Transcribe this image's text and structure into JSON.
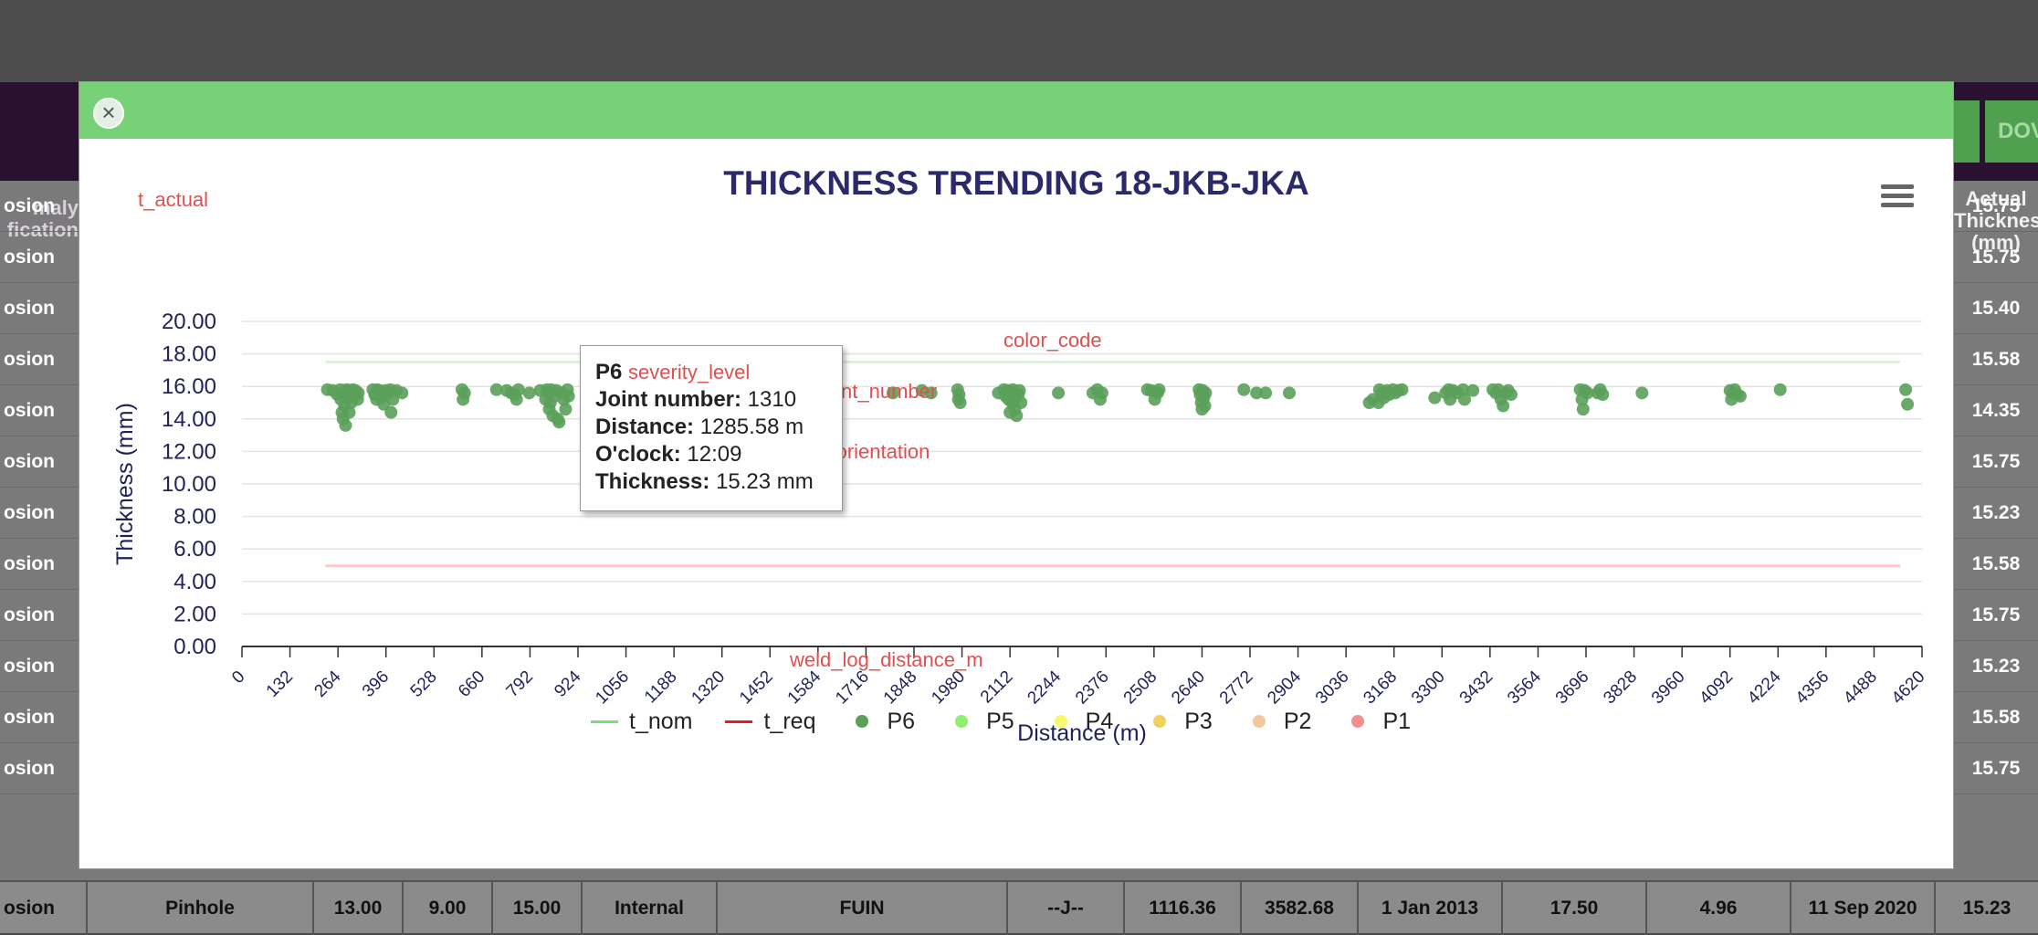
{
  "background": {
    "top_buttons": [
      "",
      "DOV"
    ],
    "left_header": [
      "maly",
      "fication"
    ],
    "right_header": [
      "Actual",
      "Thickness",
      "(mm)"
    ],
    "rows": [
      {
        "left": "osion",
        "right": "15.75"
      },
      {
        "left": "osion",
        "right": "15.75"
      },
      {
        "left": "osion",
        "right": "15.40"
      },
      {
        "left": "osion",
        "right": "15.58"
      },
      {
        "left": "osion",
        "right": "14.35"
      },
      {
        "left": "osion",
        "right": "15.75"
      },
      {
        "left": "osion",
        "right": "15.23"
      },
      {
        "left": "osion",
        "right": "15.58"
      },
      {
        "left": "osion",
        "right": "15.75"
      },
      {
        "left": "osion",
        "right": "15.23"
      },
      {
        "left": "osion",
        "right": "15.58"
      },
      {
        "left": "osion",
        "right": "15.75"
      }
    ],
    "last_row": [
      "osion",
      "Pinhole",
      "13.00",
      "9.00",
      "15.00",
      "Internal",
      "FUIN",
      "--J--",
      "1116.36",
      "3582.68",
      "1 Jan 2013",
      "17.50",
      "4.96",
      "11 Sep 2020",
      "15.23"
    ]
  },
  "modal": {
    "close_label": "×",
    "annotations": {
      "t_actual": "t_actual",
      "severity_level": "severity_level",
      "joint_number": "joint_number",
      "oclock_orientation": "oclock_orientation",
      "color_code": "color_code",
      "weld_log_distance_m": "weld_log_distance_m"
    },
    "tooltip": {
      "series": "P6",
      "joint_label": "Joint number:",
      "joint_value": "1310",
      "distance_label": "Distance:",
      "distance_value": "1285.58 m",
      "oclock_label": "O'clock:",
      "oclock_value": "12:09",
      "thickness_label": "Thickness:",
      "thickness_value": "15.23 mm"
    }
  },
  "chart_data": {
    "type": "scatter",
    "title": "THICKNESS TRENDING 18-JKB-JKA",
    "xlabel": "Distance (m)",
    "ylabel": "Thickness (mm)",
    "xlim": [
      0,
      4620
    ],
    "ylim": [
      0,
      20
    ],
    "x_ticks": [
      "0",
      "132",
      "264",
      "396",
      "528",
      "660",
      "792",
      "924",
      "1056",
      "1188",
      "1320",
      "1452",
      "1584",
      "1716",
      "1848",
      "1980",
      "2112",
      "2244",
      "2376",
      "2508",
      "2640",
      "2772",
      "2904",
      "3036",
      "3168",
      "3300",
      "3432",
      "3564",
      "3696",
      "3828",
      "3960",
      "4092",
      "4224",
      "4356",
      "4488",
      "4620"
    ],
    "y_ticks": [
      "0.00",
      "2.00",
      "4.00",
      "6.00",
      "8.00",
      "10.00",
      "12.00",
      "14.00",
      "16.00",
      "18.00",
      "20.00"
    ],
    "grid": true,
    "legend_position": "bottom",
    "lines": [
      {
        "name": "t_nom",
        "color": "#77e077",
        "x": [
          230,
          4560
        ],
        "y": [
          17.5,
          17.5
        ]
      },
      {
        "name": "t_req",
        "color": "#e02020",
        "x": [
          230,
          4560
        ],
        "y": [
          4.96,
          4.96
        ]
      }
    ],
    "legend": [
      {
        "name": "t_nom",
        "type": "line",
        "color": "#77e077"
      },
      {
        "name": "t_req",
        "type": "line",
        "color": "#e02020"
      },
      {
        "name": "P6",
        "type": "dot",
        "color": "#5aa05a"
      },
      {
        "name": "P5",
        "type": "dot",
        "color": "#90ee70"
      },
      {
        "name": "P4",
        "type": "dot",
        "color": "#f8f870"
      },
      {
        "name": "P3",
        "type": "dot",
        "color": "#f0d060"
      },
      {
        "name": "P2",
        "type": "dot",
        "color": "#f0c8a0"
      },
      {
        "name": "P1",
        "type": "dot",
        "color": "#f09090"
      }
    ],
    "series": [
      {
        "name": "P6",
        "color": "#5aa05a",
        "points": [
          [
            235,
            15.8
          ],
          [
            250,
            15.75
          ],
          [
            262,
            15.5
          ],
          [
            270,
            15.8
          ],
          [
            272,
            15.2
          ],
          [
            275,
            14.4
          ],
          [
            278,
            14.0
          ],
          [
            280,
            15.6
          ],
          [
            282,
            14.8
          ],
          [
            285,
            13.6
          ],
          [
            288,
            15.8
          ],
          [
            290,
            15.3
          ],
          [
            292,
            15.75
          ],
          [
            295,
            14.4
          ],
          [
            298,
            15.6
          ],
          [
            300,
            15.0
          ],
          [
            305,
            15.8
          ],
          [
            308,
            15.4
          ],
          [
            312,
            15.75
          ],
          [
            318,
            15.2
          ],
          [
            320,
            15.6
          ],
          [
            360,
            15.8
          ],
          [
            365,
            15.5
          ],
          [
            370,
            15.2
          ],
          [
            372,
            15.8
          ],
          [
            378,
            15.75
          ],
          [
            382,
            15.3
          ],
          [
            390,
            14.9
          ],
          [
            395,
            15.75
          ],
          [
            400,
            15.5
          ],
          [
            408,
            15.8
          ],
          [
            410,
            14.4
          ],
          [
            415,
            15.2
          ],
          [
            425,
            15.75
          ],
          [
            440,
            15.6
          ],
          [
            605,
            15.8
          ],
          [
            608,
            15.2
          ],
          [
            612,
            15.6
          ],
          [
            700,
            15.8
          ],
          [
            728,
            15.75
          ],
          [
            740,
            15.6
          ],
          [
            750,
            15.5
          ],
          [
            755,
            15.2
          ],
          [
            760,
            15.8
          ],
          [
            790,
            15.6
          ],
          [
            820,
            15.75
          ],
          [
            835,
            15.2
          ],
          [
            838,
            15.8
          ],
          [
            842,
            15.6
          ],
          [
            845,
            14.6
          ],
          [
            848,
            15.0
          ],
          [
            850,
            15.8
          ],
          [
            855,
            14.2
          ],
          [
            860,
            15.4
          ],
          [
            865,
            15.75
          ],
          [
            868,
            14.0
          ],
          [
            872,
            13.8
          ],
          [
            880,
            15.6
          ],
          [
            885,
            15.2
          ],
          [
            890,
            14.6
          ],
          [
            895,
            15.8
          ],
          [
            898,
            15.4
          ],
          [
            1035,
            15.2
          ],
          [
            1042,
            15.8
          ],
          [
            1048,
            15.6
          ],
          [
            1052,
            15.2
          ],
          [
            1160,
            15.8
          ],
          [
            1165,
            15.2
          ],
          [
            1170,
            15.6
          ],
          [
            1180,
            15.0
          ],
          [
            1188,
            15.4
          ],
          [
            1195,
            15.75
          ],
          [
            1200,
            15.2
          ],
          [
            1205,
            15.6
          ],
          [
            1250,
            15.6
          ],
          [
            1262,
            15.4
          ],
          [
            1270,
            15.2
          ],
          [
            1275,
            15.0
          ],
          [
            1280,
            15.8
          ],
          [
            1285,
            15.23
          ],
          [
            1290,
            15.6
          ],
          [
            1298,
            15.75
          ],
          [
            1305,
            15.3
          ],
          [
            1312,
            14.2
          ],
          [
            1318,
            15.8
          ],
          [
            1322,
            15.4
          ],
          [
            1330,
            15.75
          ],
          [
            1345,
            15.8
          ],
          [
            1355,
            15.6
          ],
          [
            1370,
            15.2
          ],
          [
            1372,
            15.75
          ],
          [
            1400,
            15.8
          ],
          [
            1405,
            15.6
          ],
          [
            1410,
            15.0
          ],
          [
            1412,
            15.2
          ],
          [
            1420,
            14.8
          ],
          [
            1425,
            15.75
          ],
          [
            1430,
            15.3
          ],
          [
            1435,
            15.6
          ],
          [
            1440,
            14.6
          ],
          [
            1445,
            15.8
          ],
          [
            1450,
            15.4
          ],
          [
            1455,
            15.75
          ],
          [
            1460,
            15.6
          ],
          [
            1465,
            15.2
          ],
          [
            1470,
            15.75
          ],
          [
            1480,
            15.3
          ],
          [
            1490,
            15.75
          ],
          [
            1500,
            15.8
          ],
          [
            1510,
            15.6
          ],
          [
            1610,
            15.3
          ],
          [
            1790,
            15.6
          ],
          [
            1870,
            15.75
          ],
          [
            1895,
            15.6
          ],
          [
            1968,
            15.8
          ],
          [
            1970,
            15.2
          ],
          [
            1972,
            15.5
          ],
          [
            1975,
            15.0
          ],
          [
            2080,
            15.6
          ],
          [
            2095,
            15.8
          ],
          [
            2100,
            15.4
          ],
          [
            2105,
            15.75
          ],
          [
            2108,
            15.2
          ],
          [
            2112,
            14.4
          ],
          [
            2115,
            15.6
          ],
          [
            2118,
            15.0
          ],
          [
            2120,
            15.8
          ],
          [
            2125,
            14.6
          ],
          [
            2128,
            15.3
          ],
          [
            2130,
            14.2
          ],
          [
            2135,
            15.5
          ],
          [
            2138,
            15.75
          ],
          [
            2142,
            15.0
          ],
          [
            2245,
            15.6
          ],
          [
            2340,
            15.6
          ],
          [
            2352,
            15.8
          ],
          [
            2360,
            15.2
          ],
          [
            2365,
            15.6
          ],
          [
            2490,
            15.8
          ],
          [
            2500,
            15.75
          ],
          [
            2510,
            15.2
          ],
          [
            2518,
            15.6
          ],
          [
            2522,
            15.8
          ],
          [
            2632,
            15.8
          ],
          [
            2635,
            15.5
          ],
          [
            2638,
            15.0
          ],
          [
            2640,
            14.6
          ],
          [
            2642,
            15.75
          ],
          [
            2645,
            15.3
          ],
          [
            2648,
            14.8
          ],
          [
            2650,
            15.6
          ],
          [
            2755,
            15.8
          ],
          [
            2790,
            15.6
          ],
          [
            2815,
            15.6
          ],
          [
            2880,
            15.6
          ],
          [
            3100,
            15.0
          ],
          [
            3110,
            15.2
          ],
          [
            3125,
            15.0
          ],
          [
            3128,
            15.8
          ],
          [
            3135,
            15.6
          ],
          [
            3140,
            15.3
          ],
          [
            3148,
            15.75
          ],
          [
            3155,
            15.5
          ],
          [
            3165,
            15.8
          ],
          [
            3172,
            15.6
          ],
          [
            3180,
            15.75
          ],
          [
            3190,
            15.8
          ],
          [
            3280,
            15.3
          ],
          [
            3310,
            15.6
          ],
          [
            3318,
            15.8
          ],
          [
            3322,
            15.2
          ],
          [
            3330,
            15.75
          ],
          [
            3342,
            15.6
          ],
          [
            3358,
            15.8
          ],
          [
            3362,
            15.2
          ],
          [
            3385,
            15.75
          ],
          [
            3440,
            15.8
          ],
          [
            3448,
            15.6
          ],
          [
            3455,
            15.8
          ],
          [
            3462,
            15.2
          ],
          [
            3468,
            14.8
          ],
          [
            3475,
            15.6
          ],
          [
            3482,
            15.75
          ],
          [
            3490,
            15.5
          ],
          [
            3680,
            15.8
          ],
          [
            3685,
            15.2
          ],
          [
            3688,
            14.6
          ],
          [
            3692,
            15.75
          ],
          [
            3700,
            15.6
          ],
          [
            3728,
            15.6
          ],
          [
            3735,
            15.8
          ],
          [
            3742,
            15.5
          ],
          [
            3850,
            15.6
          ],
          [
            4092,
            15.75
          ],
          [
            4096,
            15.2
          ],
          [
            4100,
            15.6
          ],
          [
            4105,
            15.8
          ],
          [
            4112,
            15.5
          ],
          [
            4120,
            15.4
          ],
          [
            4230,
            15.8
          ],
          [
            4575,
            15.8
          ],
          [
            4580,
            14.9
          ]
        ]
      }
    ]
  }
}
